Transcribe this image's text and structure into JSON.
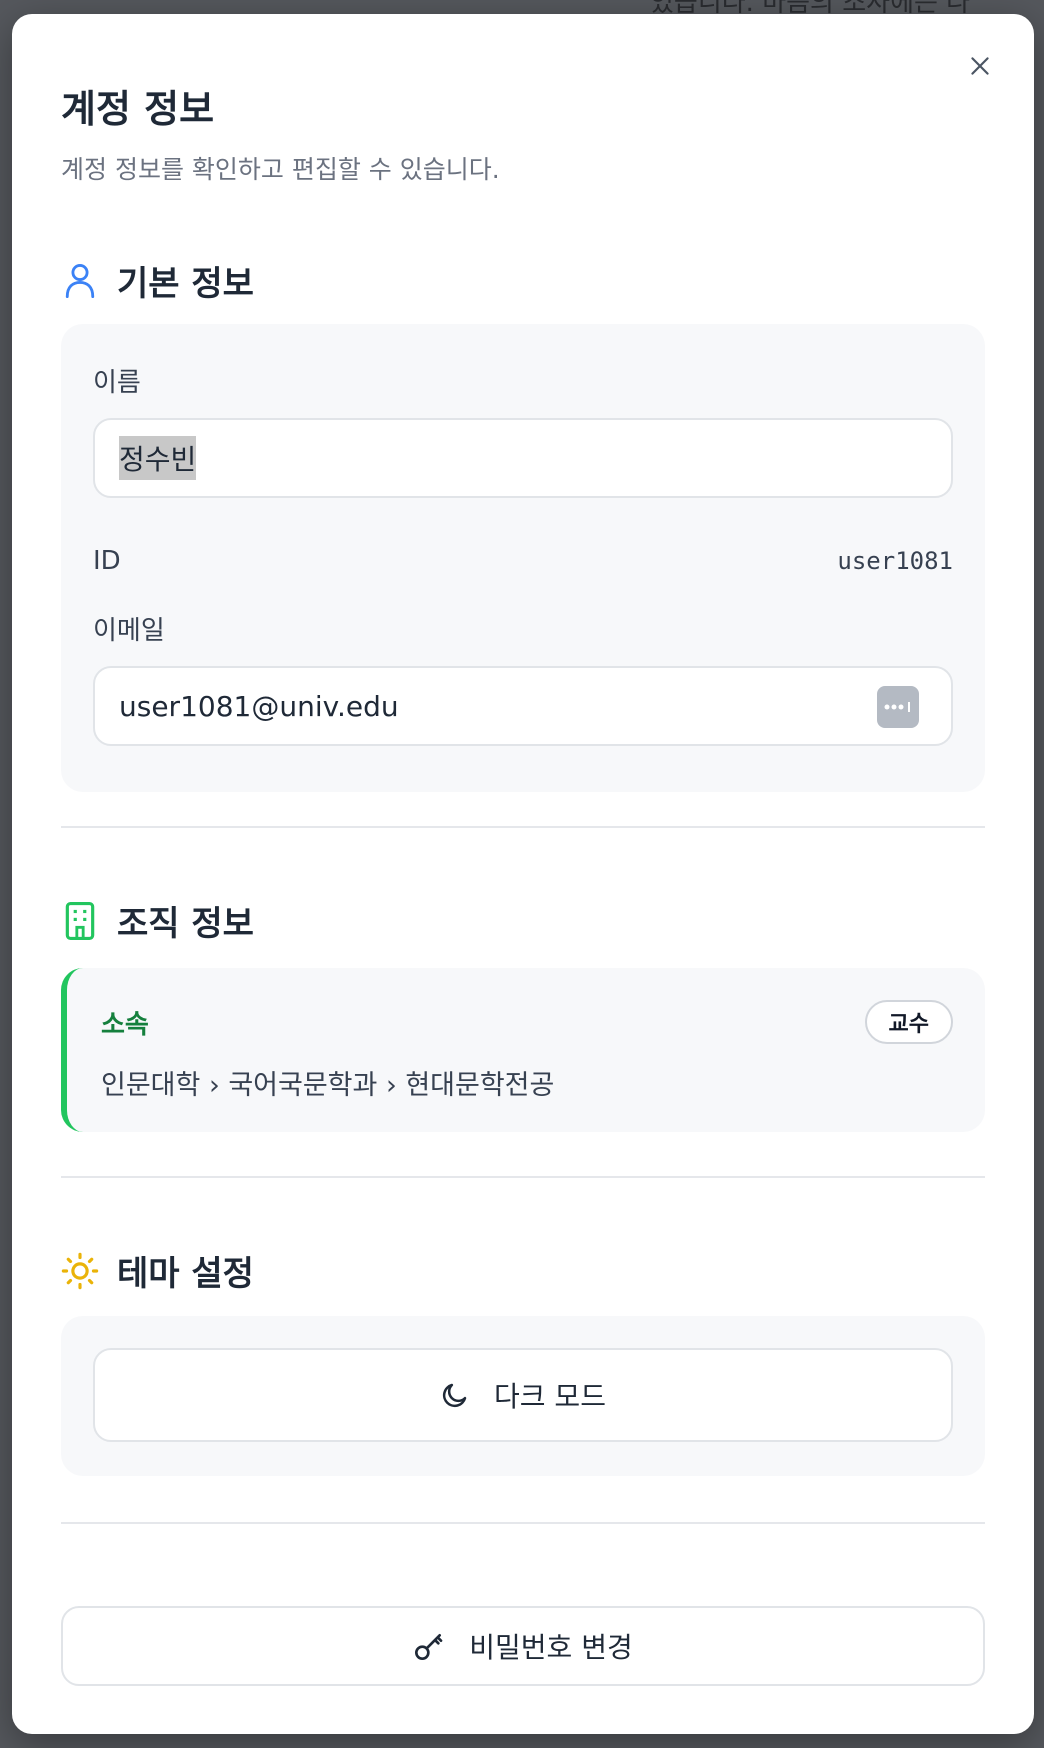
{
  "backdrop": {
    "text": "있습니다. 마음의 조사에는 나"
  },
  "modal": {
    "title": "계정 정보",
    "subtitle": "계정 정보를 확인하고 편집할 수 있습니다.",
    "close_icon": "close-icon"
  },
  "basic_info": {
    "heading": "기본 정보",
    "icon": "user-icon",
    "name_label": "이름",
    "name_value": "정수빈",
    "id_label": "ID",
    "id_value": "user1081",
    "email_label": "이메일",
    "email_value": "user1081@univ.edu"
  },
  "org_info": {
    "heading": "조직 정보",
    "icon": "building-icon",
    "affiliation_label": "소속",
    "affiliation_path": "인문대학 › 국어국문학과 › 현대문학전공",
    "role_badge": "교수",
    "accent_color": "#22c55e"
  },
  "theme": {
    "heading": "테마 설정",
    "icon": "sun-icon",
    "dark_mode_label": "다크 모드",
    "dark_mode_icon": "moon-icon"
  },
  "password": {
    "change_label": "비밀번호 변경",
    "icon": "key-icon"
  }
}
